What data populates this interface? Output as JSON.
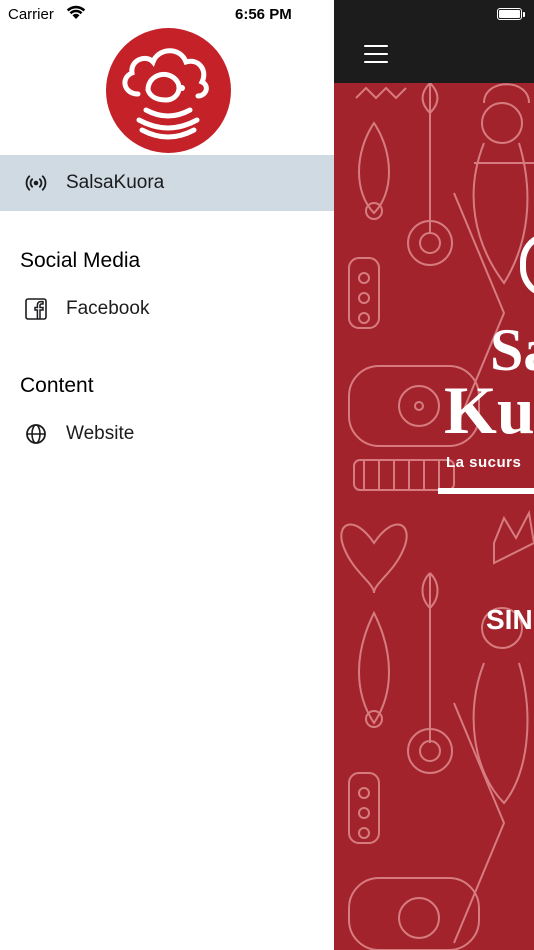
{
  "status_bar": {
    "carrier": "Carrier",
    "time": "6:56 PM"
  },
  "drawer": {
    "selected_item": {
      "label": "SalsaKuora",
      "icon": "radio-broadcast-icon"
    },
    "sections": [
      {
        "title": "Social Media",
        "items": [
          {
            "label": "Facebook",
            "icon": "facebook-icon"
          }
        ]
      },
      {
        "title": "Content",
        "items": [
          {
            "label": "Website",
            "icon": "globe-icon"
          }
        ]
      }
    ],
    "logo_icon": "cloud-radio-logo"
  },
  "main": {
    "menu_icon": "hamburger-menu-icon",
    "banner": {
      "line1": "Sa",
      "line2": "Ku",
      "tagline": "La sucurs",
      "partial_text": "SIN"
    }
  },
  "colors": {
    "brand_red": "#c42129",
    "background_red": "#a3232c",
    "selected_row": "#cfdae3",
    "navbar": "#1c1c1c"
  }
}
